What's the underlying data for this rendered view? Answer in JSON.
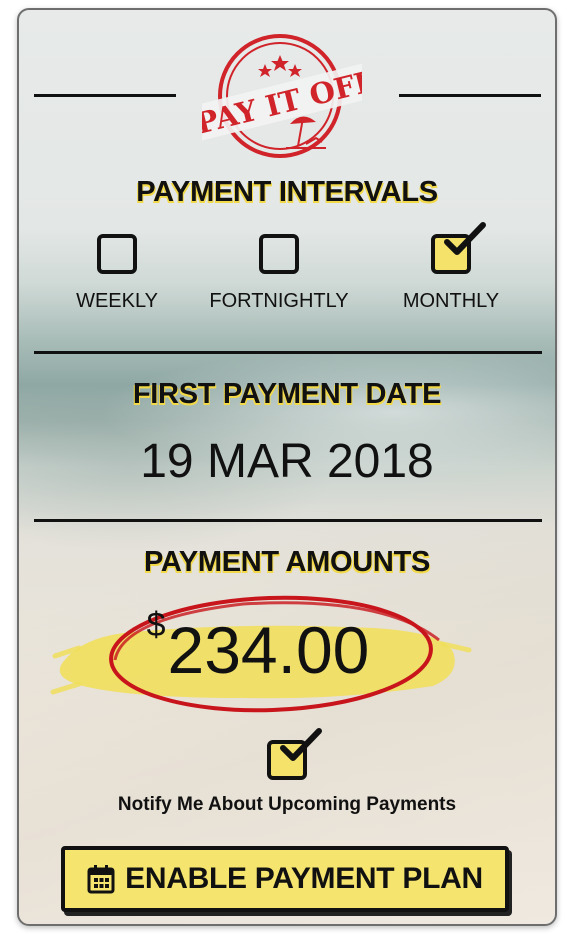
{
  "logo": {
    "text": "PAY IT OFF",
    "icon": "beach-umbrella-icon",
    "color": "#d0232a"
  },
  "intervals": {
    "heading": "PAYMENT INTERVALS",
    "options": [
      {
        "label": "WEEKLY",
        "checked": false
      },
      {
        "label": "FORTNIGHTLY",
        "checked": false
      },
      {
        "label": "MONTHLY",
        "checked": true
      }
    ]
  },
  "first_payment": {
    "heading": "FIRST PAYMENT DATE",
    "date": "19 MAR 2018"
  },
  "amounts": {
    "heading": "PAYMENT AMOUNTS",
    "currency": "$",
    "value": "234.00"
  },
  "notify": {
    "label": "Notify Me About Upcoming Payments",
    "checked": true
  },
  "cta": {
    "label": "ENABLE PAYMENT PLAN",
    "icon": "calendar-icon"
  },
  "colors": {
    "accent_yellow": "#f4e26a",
    "stamp_red": "#d0232a",
    "text": "#111111"
  }
}
